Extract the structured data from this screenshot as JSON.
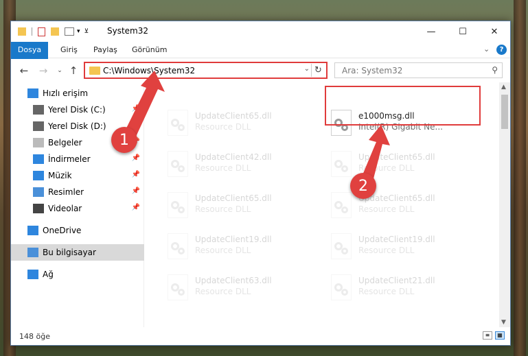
{
  "window": {
    "title": "System32",
    "controls": {
      "minimize": "—",
      "maximize": "☐",
      "close": "✕"
    }
  },
  "ribbon": {
    "tabs": [
      "Dosya",
      "Giriş",
      "Paylaş",
      "Görünüm"
    ],
    "help_glyph": "?",
    "collapse_glyph": "⌄"
  },
  "address": {
    "path": "C:\\Windows\\System32",
    "search_placeholder": "Ara: System32"
  },
  "sidebar": {
    "items": [
      {
        "label": "Hızlı erişim",
        "icon": "star-icon",
        "pinned": false
      },
      {
        "label": "Yerel Disk (C:)",
        "icon": "drive-icon",
        "pinned": true
      },
      {
        "label": "Yerel Disk (D:)",
        "icon": "drive-icon",
        "pinned": true
      },
      {
        "label": "Belgeler",
        "icon": "documents-icon",
        "pinned": true
      },
      {
        "label": "İndirmeler",
        "icon": "download-icon",
        "pinned": true
      },
      {
        "label": "Müzik",
        "icon": "music-icon",
        "pinned": true
      },
      {
        "label": "Resimler",
        "icon": "pictures-icon",
        "pinned": true
      },
      {
        "label": "Videolar",
        "icon": "videos-icon",
        "pinned": true
      },
      {
        "label": "OneDrive",
        "icon": "cloud-icon",
        "pinned": false
      },
      {
        "label": "Bu bilgisayar",
        "icon": "computer-icon",
        "pinned": false,
        "selected": true
      },
      {
        "label": "Ağ",
        "icon": "network-icon",
        "pinned": false
      }
    ]
  },
  "files": {
    "left_column": [
      {
        "name": "UpdateClient65.dll",
        "desc": "Resource DLL"
      },
      {
        "name": "UpdateClient42.dll",
        "desc": "Resource DLL"
      },
      {
        "name": "UpdateClient65.dll",
        "desc": "Resource DLL"
      },
      {
        "name": "UpdateClient19.dll",
        "desc": "Resource DLL"
      },
      {
        "name": "UpdateClient63.dll",
        "desc": "Resource DLL"
      }
    ],
    "right_column": [
      {
        "name": "e1000msg.dll",
        "desc": "Intel(R) Gigabit Ne...",
        "highlighted": true
      },
      {
        "name": "UpdateClient65.dll",
        "desc": "Resource DLL"
      },
      {
        "name": "UpdateClient65.dll",
        "desc": "Resource DLL"
      },
      {
        "name": "UpdateClient19.dll",
        "desc": "Resource DLL"
      },
      {
        "name": "UpdateClient21.dll",
        "desc": "Resource DLL"
      }
    ]
  },
  "status": {
    "item_count": "148 öğe"
  },
  "annotations": {
    "step1": "1",
    "step2": "2",
    "color": "#e0413f"
  }
}
